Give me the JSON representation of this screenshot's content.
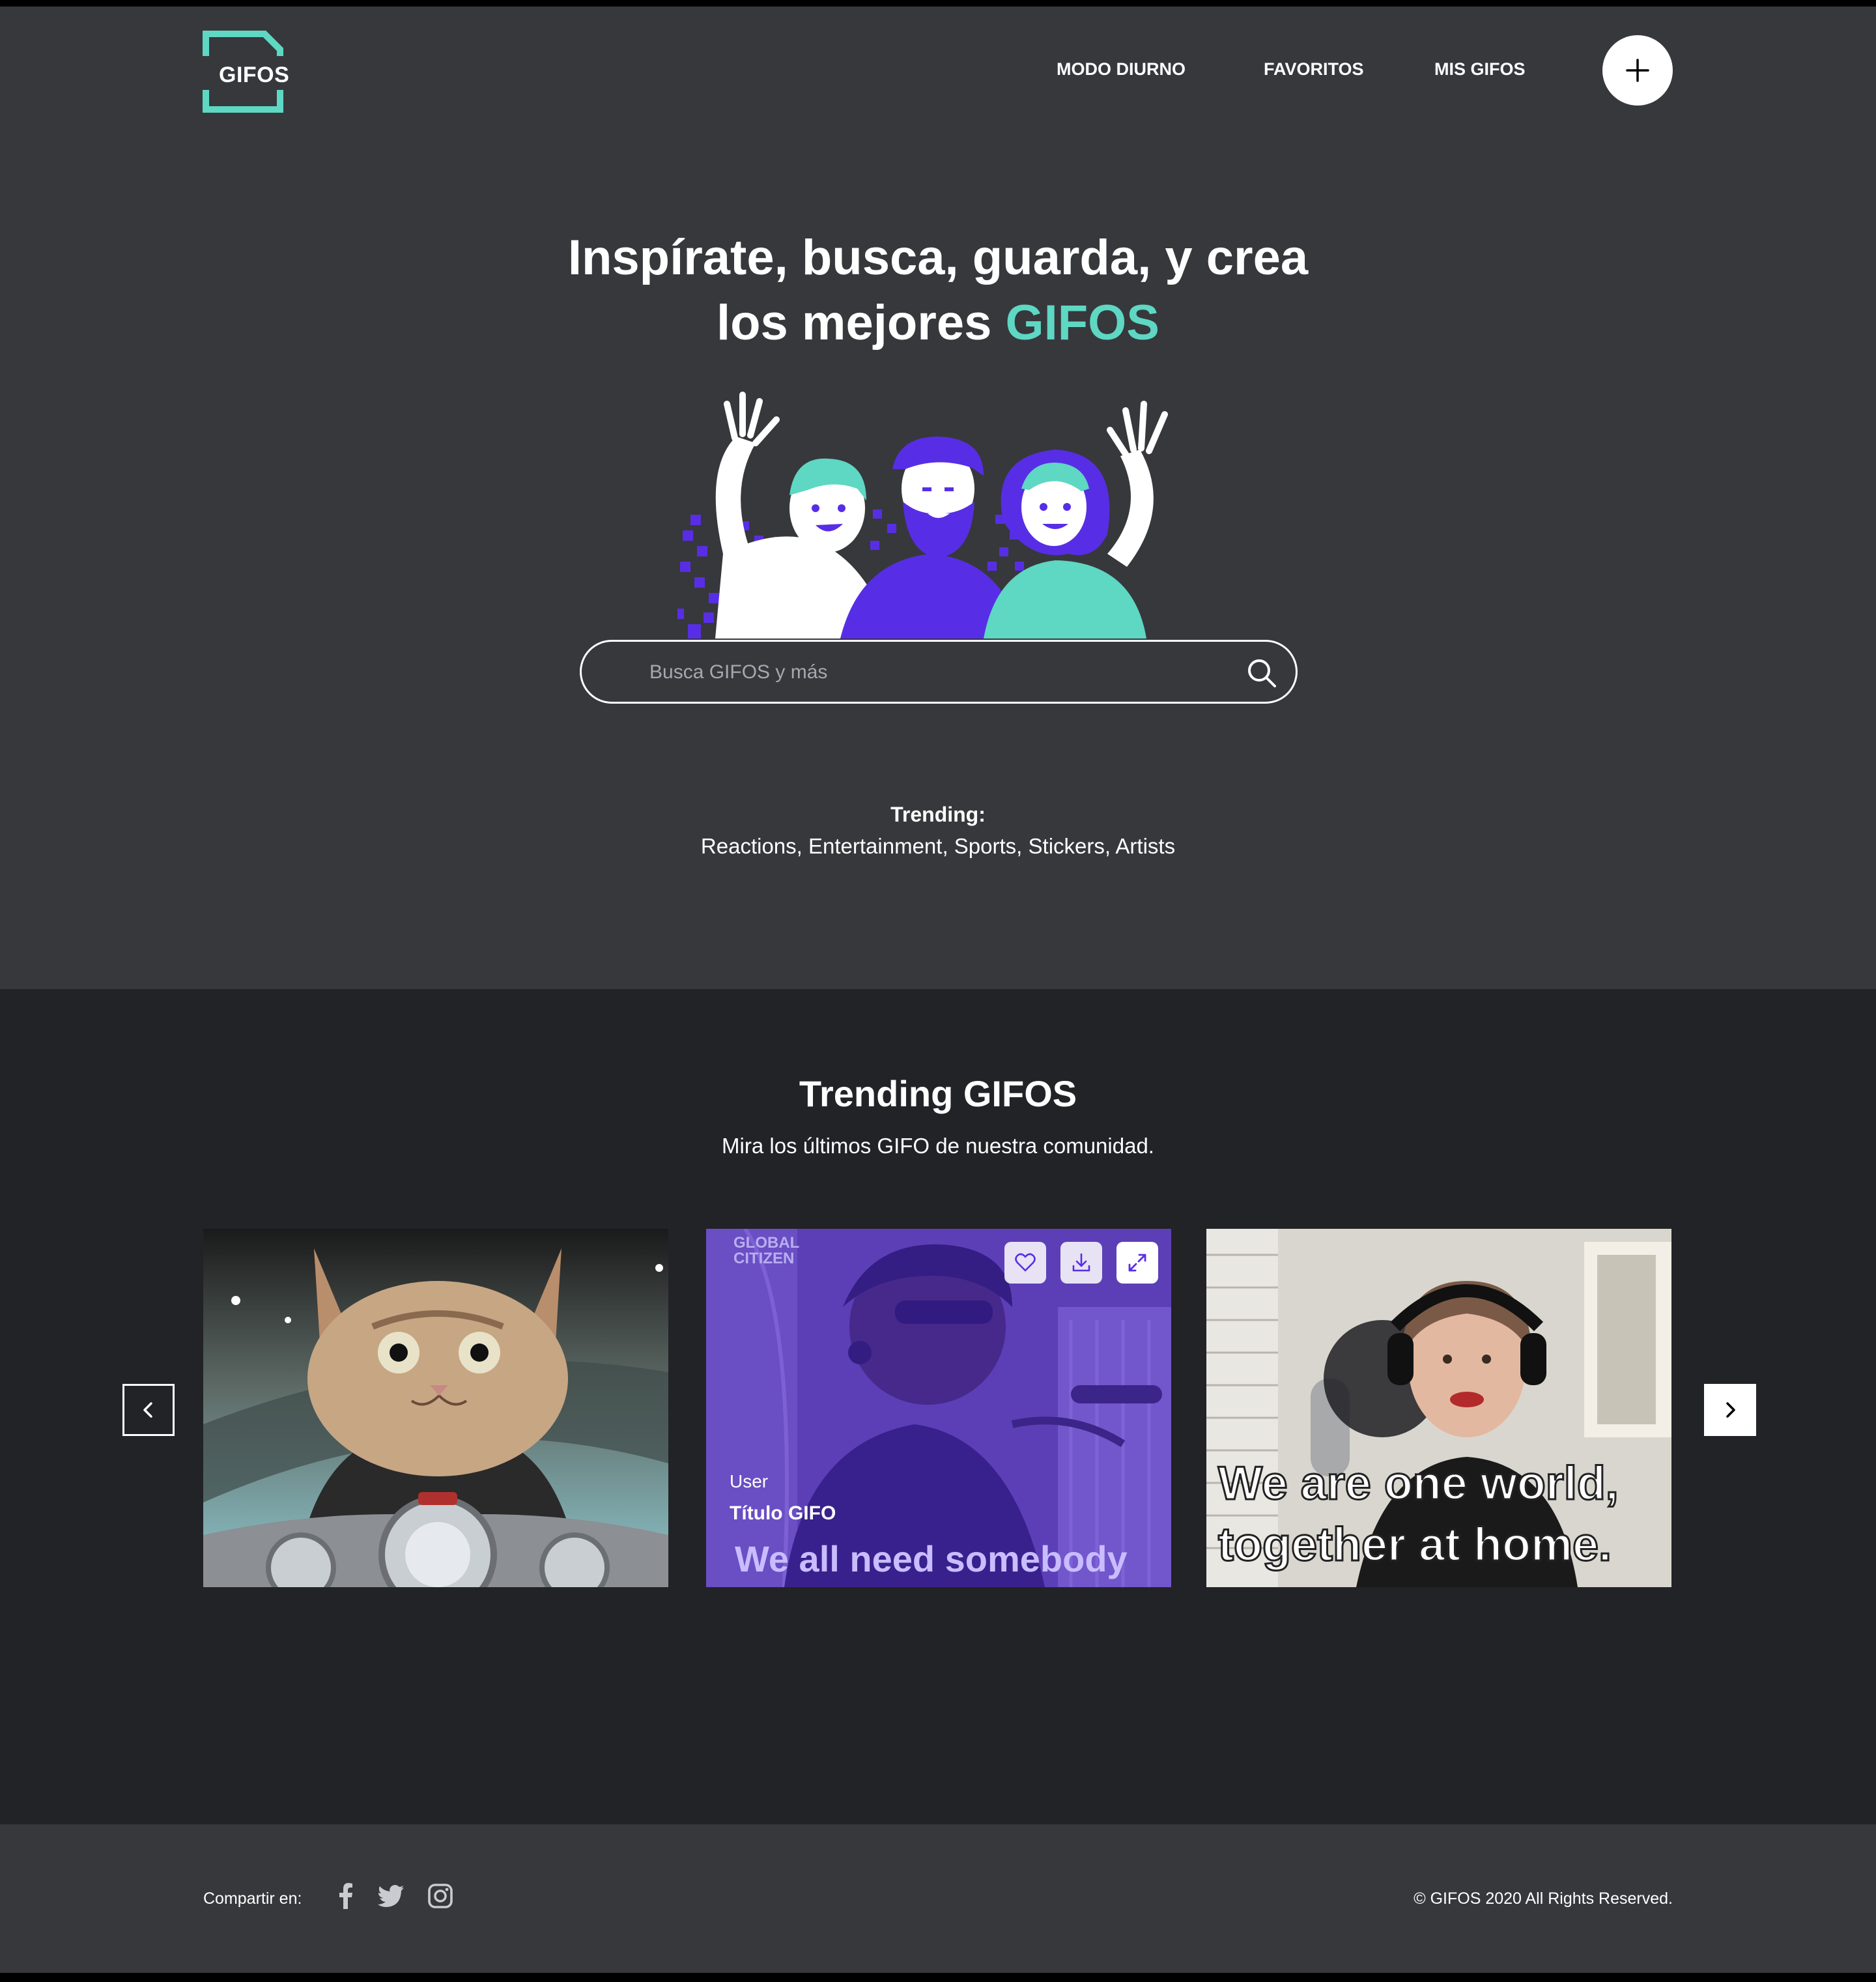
{
  "brand": {
    "logo_text": "GIFOS",
    "accent_color": "#5ed7c3",
    "purple": "#572ee5"
  },
  "nav": {
    "items": [
      "MODO DIURNO",
      "FAVORITOS",
      "MIS GIFOS"
    ]
  },
  "hero": {
    "title_line1": "Inspírate, busca, guarda, y crea",
    "title_line2_prefix": "los mejores ",
    "title_line2_accent": "GIFOS"
  },
  "search": {
    "placeholder": "Busca GIFOS y más",
    "value": ""
  },
  "trending": {
    "label": "Trending:",
    "tags": [
      "Reactions",
      "Entertainment",
      "Sports",
      "Stickers",
      "Artists"
    ]
  },
  "trending_gifos": {
    "title": "Trending GIFOS",
    "subtitle": "Mira los últimos GIFO de nuestra comunidad.",
    "cards": [
      {
        "user": "",
        "title": "",
        "caption": ""
      },
      {
        "user": "User",
        "title": "Título GIFO",
        "caption": "We all need somebody",
        "watermark_line1": "GLOBAL",
        "watermark_line2": "CITIZEN"
      },
      {
        "user": "",
        "title": "",
        "caption_line1": "We are one world,",
        "caption_line2": "together at home."
      }
    ]
  },
  "footer": {
    "share_label": "Compartir en:",
    "social": [
      "facebook-icon",
      "twitter-icon",
      "instagram-icon"
    ],
    "copyright": "© GIFOS 2020 All Rights Reserved."
  }
}
